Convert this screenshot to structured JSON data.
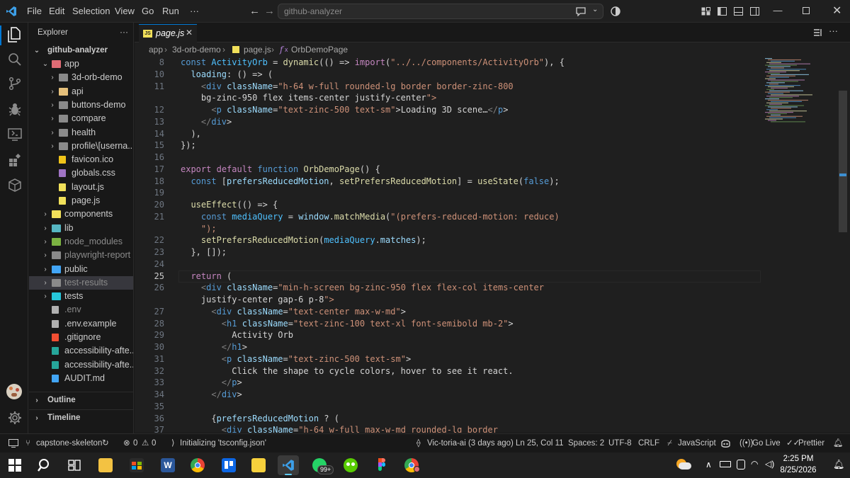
{
  "titlebar": {
    "menus": [
      "File",
      "Edit",
      "Selection",
      "View",
      "Go",
      "Run",
      "···"
    ],
    "search_placeholder": "github-analyzer"
  },
  "sidebar": {
    "header": "Explorer",
    "more": "···",
    "root": "github-analyzer",
    "items": [
      {
        "label": "app",
        "type": "folder-open",
        "depth": 1,
        "color": "#e06c75"
      },
      {
        "label": "3d-orb-demo",
        "type": "folder",
        "depth": 2,
        "color": "#8a8a8a"
      },
      {
        "label": "api",
        "type": "folder",
        "depth": 2,
        "color": "#e5c07b"
      },
      {
        "label": "buttons-demo",
        "type": "folder",
        "depth": 2,
        "color": "#8a8a8a"
      },
      {
        "label": "compare",
        "type": "folder",
        "depth": 2,
        "color": "#8a8a8a"
      },
      {
        "label": "health",
        "type": "folder",
        "depth": 2,
        "color": "#8a8a8a"
      },
      {
        "label": "profile\\[userna...",
        "type": "folder",
        "depth": 2,
        "color": "#8a8a8a"
      },
      {
        "label": "favicon.ico",
        "type": "file-star",
        "depth": 2,
        "color": "#f0c419"
      },
      {
        "label": "globals.css",
        "type": "file-css",
        "depth": 2,
        "color": "#a074c4"
      },
      {
        "label": "layout.js",
        "type": "file-js",
        "depth": 2,
        "color": "#f1e05a"
      },
      {
        "label": "page.js",
        "type": "file-js",
        "depth": 2,
        "color": "#f1e05a"
      },
      {
        "label": "components",
        "type": "folder",
        "depth": 1,
        "color": "#f1e05a"
      },
      {
        "label": "lib",
        "type": "folder",
        "depth": 1,
        "color": "#56b6c2"
      },
      {
        "label": "node_modules",
        "type": "folder",
        "depth": 1,
        "color": "#7cb342",
        "dim": true
      },
      {
        "label": "playwright-report",
        "type": "folder",
        "depth": 1,
        "color": "#8a8a8a",
        "dim": true
      },
      {
        "label": "public",
        "type": "folder",
        "depth": 1,
        "color": "#42a5f5"
      },
      {
        "label": "test-results",
        "type": "folder",
        "depth": 1,
        "color": "#8a8a8a",
        "dim": true,
        "selected": true
      },
      {
        "label": "tests",
        "type": "folder",
        "depth": 1,
        "color": "#26c6da"
      },
      {
        "label": ".env",
        "type": "file-env",
        "depth": 1,
        "color": "#b0b0b0",
        "dim": true
      },
      {
        "label": ".env.example",
        "type": "file-env",
        "depth": 1,
        "color": "#b0b0b0"
      },
      {
        "label": ".gitignore",
        "type": "file-git",
        "depth": 1,
        "color": "#f14e32"
      },
      {
        "label": "accessibility-afte...",
        "type": "file-json",
        "depth": 1,
        "color": "#26a69a"
      },
      {
        "label": "accessibility-afte...",
        "type": "file-json",
        "depth": 1,
        "color": "#26a69a"
      },
      {
        "label": "AUDIT.md",
        "type": "file-md",
        "depth": 1,
        "color": "#42a5f5"
      }
    ],
    "outline": "Outline",
    "timeline": "Timeline"
  },
  "editor": {
    "tab_label": "page.js",
    "tab_icon": "JS",
    "breadcrumb": [
      "app",
      "3d-orb-demo",
      "page.js",
      "OrbDemoPage"
    ],
    "line_numbers": [
      "8",
      "10",
      "11",
      "",
      "12",
      "13",
      "14",
      "15",
      "16",
      "17",
      "18",
      "19",
      "20",
      "21",
      "",
      "22",
      "23",
      "24",
      "25",
      "26",
      "",
      "27",
      "28",
      "29",
      "30",
      "31",
      "32",
      "33",
      "34",
      "35",
      "36",
      "37"
    ],
    "active_line": "25",
    "lines": [
      "const ActivityOrb = dynamic(() => import(\"../../components/ActivityOrb\"), {",
      "  loading: () => (",
      "    <div className=\"h-64 w-full rounded-lg border border-zinc-800",
      "    bg-zinc-950 flex items-center justify-center\">",
      "      <p className=\"text-zinc-500 text-sm\">Loading 3D scene…</p>",
      "    </div>",
      "  ),",
      "});",
      "",
      "export default function OrbDemoPage() {",
      "  const [prefersReducedMotion, setPrefersReducedMotion] = useState(false);",
      "",
      "  useEffect(() => {",
      "    const mediaQuery = window.matchMedia(\"(prefers-reduced-motion: reduce)",
      "    \");",
      "    setPrefersReducedMotion(mediaQuery.matches);",
      "  }, []);",
      "",
      "  return (",
      "    <div className=\"min-h-screen bg-zinc-950 flex flex-col items-center",
      "    justify-center gap-6 p-8\">",
      "      <div className=\"text-center max-w-md\">",
      "        <h1 className=\"text-zinc-100 text-xl font-semibold mb-2\">",
      "          Activity Orb",
      "        </h1>",
      "        <p className=\"text-zinc-500 text-sm\">",
      "          Click the shape to cycle colors, hover to see it react.",
      "        </p>",
      "      </div>",
      "",
      "      {prefersReducedMotion ? (",
      "        <div className=\"h-64 w-full max-w-md rounded-lg border"
    ]
  },
  "statusbar": {
    "branch": "capstone-skeleton",
    "errors": "0",
    "warnings": "0",
    "initializing": "Initializing 'tsconfig.json'",
    "git_author": "Vic-toria-ai (3 days ago)",
    "position": "Ln 25, Col 11",
    "spaces": "Spaces: 2",
    "encoding": "UTF-8",
    "eol": "CRLF",
    "language": "JavaScript",
    "go_live": "Go Live",
    "prettier": "Prettier"
  },
  "taskbar": {
    "time": "2:25 PM",
    "date": "8/25/2026",
    "whatsapp_badge": "99+",
    "apps": [
      "file-explorer-icon",
      "microsoft-store-icon",
      "word-icon",
      "chrome-icon",
      "trello-icon",
      "sticky-notes-icon",
      "vscode-icon",
      "whatsapp-icon",
      "duolingo-icon",
      "figma-icon",
      "chrome-profile-icon"
    ]
  },
  "colors": {
    "accent": "#0078d4",
    "editor_bg": "#1f1f1f",
    "keyword": "#c586c0",
    "storage": "#569cd6",
    "string": "#ce9178",
    "function": "#dcdcaa",
    "variable": "#9cdcfe",
    "tag": "#569cd6",
    "attr": "#9cdcfe",
    "const": "#4fc1ff"
  }
}
